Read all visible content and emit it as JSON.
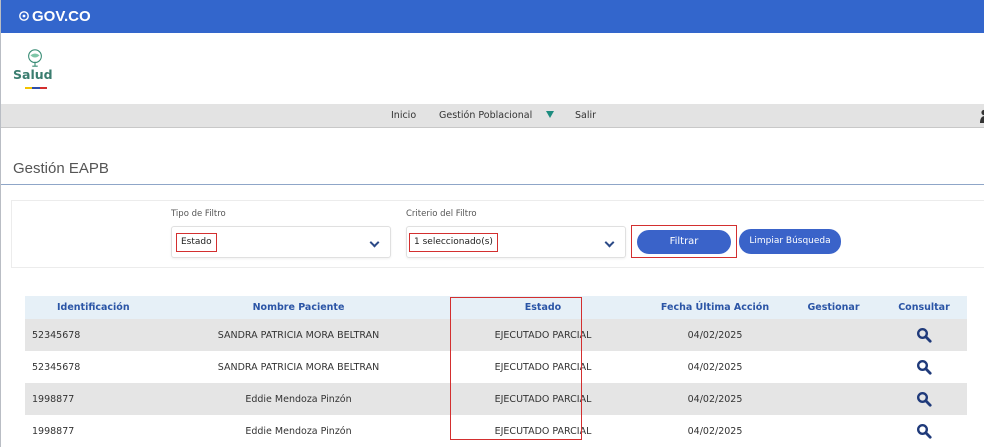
{
  "gov_bar": {
    "logo_text": "GOV.CO"
  },
  "brand": {
    "name": "Salud"
  },
  "nav": {
    "items": [
      {
        "label": "Inicio"
      },
      {
        "label": "Gestión Poblacional"
      },
      {
        "label": "Salir"
      }
    ]
  },
  "page": {
    "title": "Gestión EAPB"
  },
  "filters": {
    "tipo_label": "Tipo de Filtro",
    "tipo_value": "Estado",
    "criterio_label": "Criterio del Filtro",
    "criterio_value": "1 seleccionado(s)",
    "filtrar_label": "Filtrar",
    "limpiar_label": "Limpiar Búsqueda"
  },
  "table": {
    "headers": [
      "Identificación",
      "Nombre Paciente",
      "Estado",
      "Fecha Última Acción",
      "Gestionar",
      "Consultar"
    ],
    "rows": [
      {
        "id": "52345678",
        "name": "SANDRA PATRICIA MORA BELTRAN",
        "estado": "EJECUTADO PARCIAL",
        "fecha": "04/02/2025",
        "gestionar": ""
      },
      {
        "id": "52345678",
        "name": "SANDRA PATRICIA MORA BELTRAN",
        "estado": "EJECUTADO PARCIAL",
        "fecha": "04/02/2025",
        "gestionar": ""
      },
      {
        "id": "1998877",
        "name": "Eddie Mendoza Pinzón",
        "estado": "EJECUTADO PARCIAL",
        "fecha": "04/02/2025",
        "gestionar": ""
      },
      {
        "id": "1998877",
        "name": "Eddie Mendoza Pinzón",
        "estado": "EJECUTADO PARCIAL",
        "fecha": "04/02/2025",
        "gestionar": ""
      }
    ]
  },
  "colors": {
    "gov_blue": "#3366cc",
    "button_blue": "#3a63c9",
    "header_text": "#2b55a6",
    "highlight_red": "#d32f2f",
    "icon_navy": "#1f3a7a"
  },
  "icons": {
    "gov_logo": "gov-shield-icon",
    "brand": "salud-emblem-icon",
    "caret": "caret-down-icon",
    "chevron": "chevron-down-icon",
    "consult": "search-icon",
    "user": "user-icon"
  }
}
